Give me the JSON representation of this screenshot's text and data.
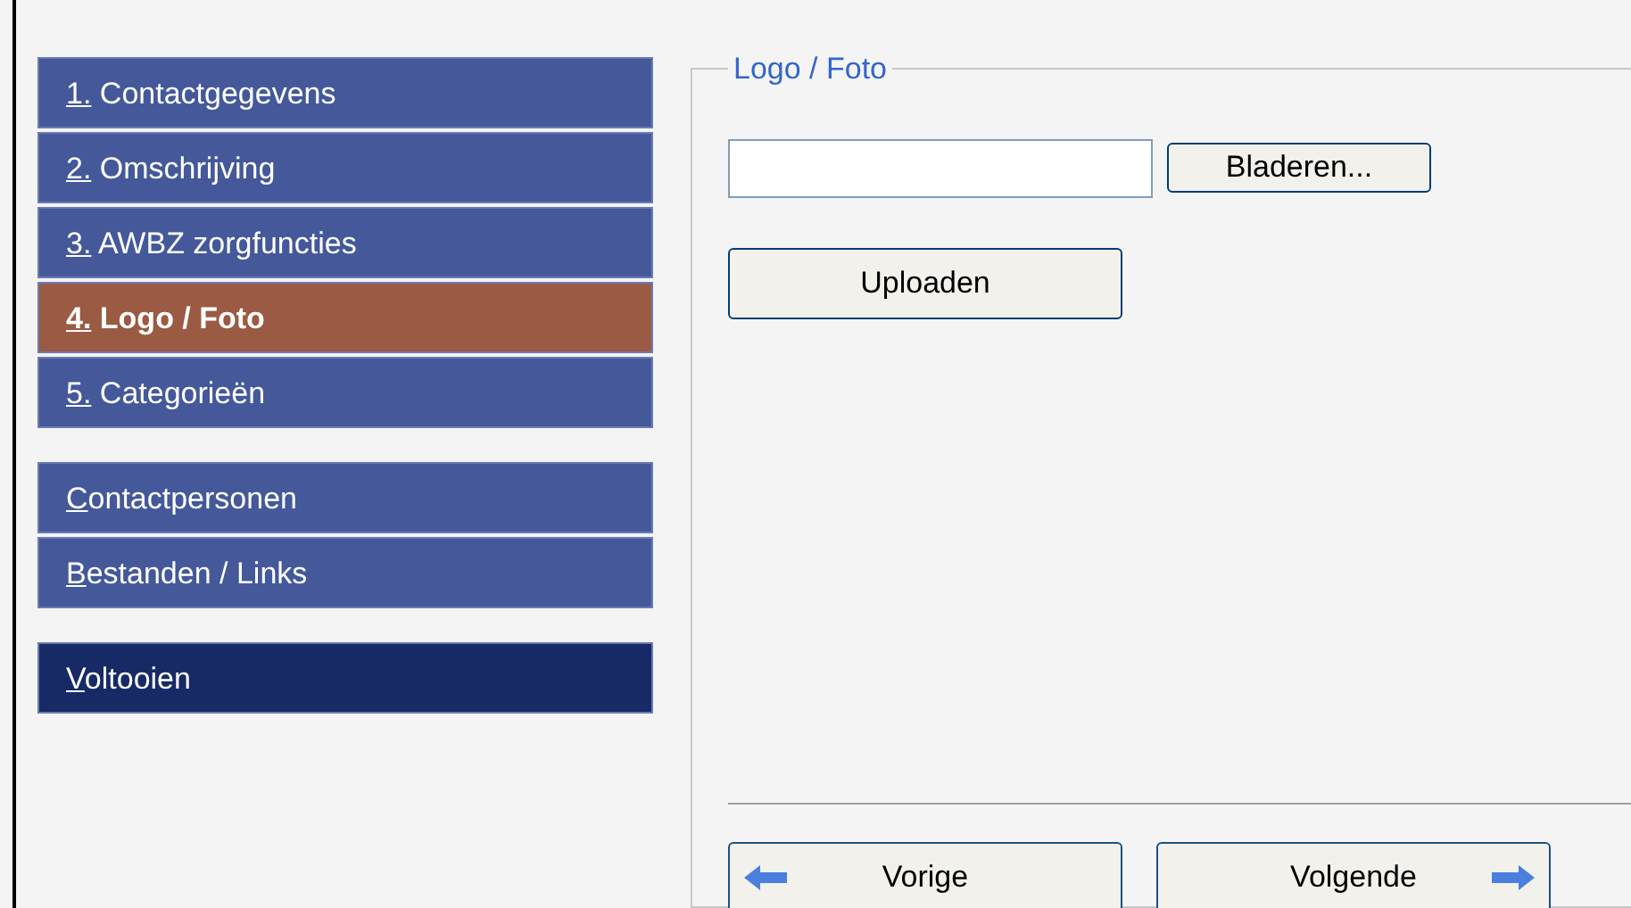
{
  "nav": [
    {
      "label": "1. Contactgegevens",
      "kind": "step",
      "selected": false
    },
    {
      "label": "2. Omschrijving",
      "kind": "step",
      "selected": false
    },
    {
      "label": "3. AWBZ zorgfuncties",
      "kind": "step",
      "selected": false
    },
    {
      "label": "4. Logo / Foto",
      "kind": "step",
      "selected": true
    },
    {
      "label": "5. Categorieën",
      "kind": "step",
      "selected": false
    },
    {
      "label": "Contactpersonen",
      "kind": "link",
      "selected": false
    },
    {
      "label": "Bestanden / Links",
      "kind": "link",
      "selected": false
    },
    {
      "label": "Voltooien",
      "kind": "finish",
      "selected": false
    }
  ],
  "panel": {
    "legend": "Logo / Foto",
    "browse_button": "Bladeren...",
    "upload_button": "Uploaden",
    "previous_button": "Vorige",
    "next_button": "Volgende"
  }
}
